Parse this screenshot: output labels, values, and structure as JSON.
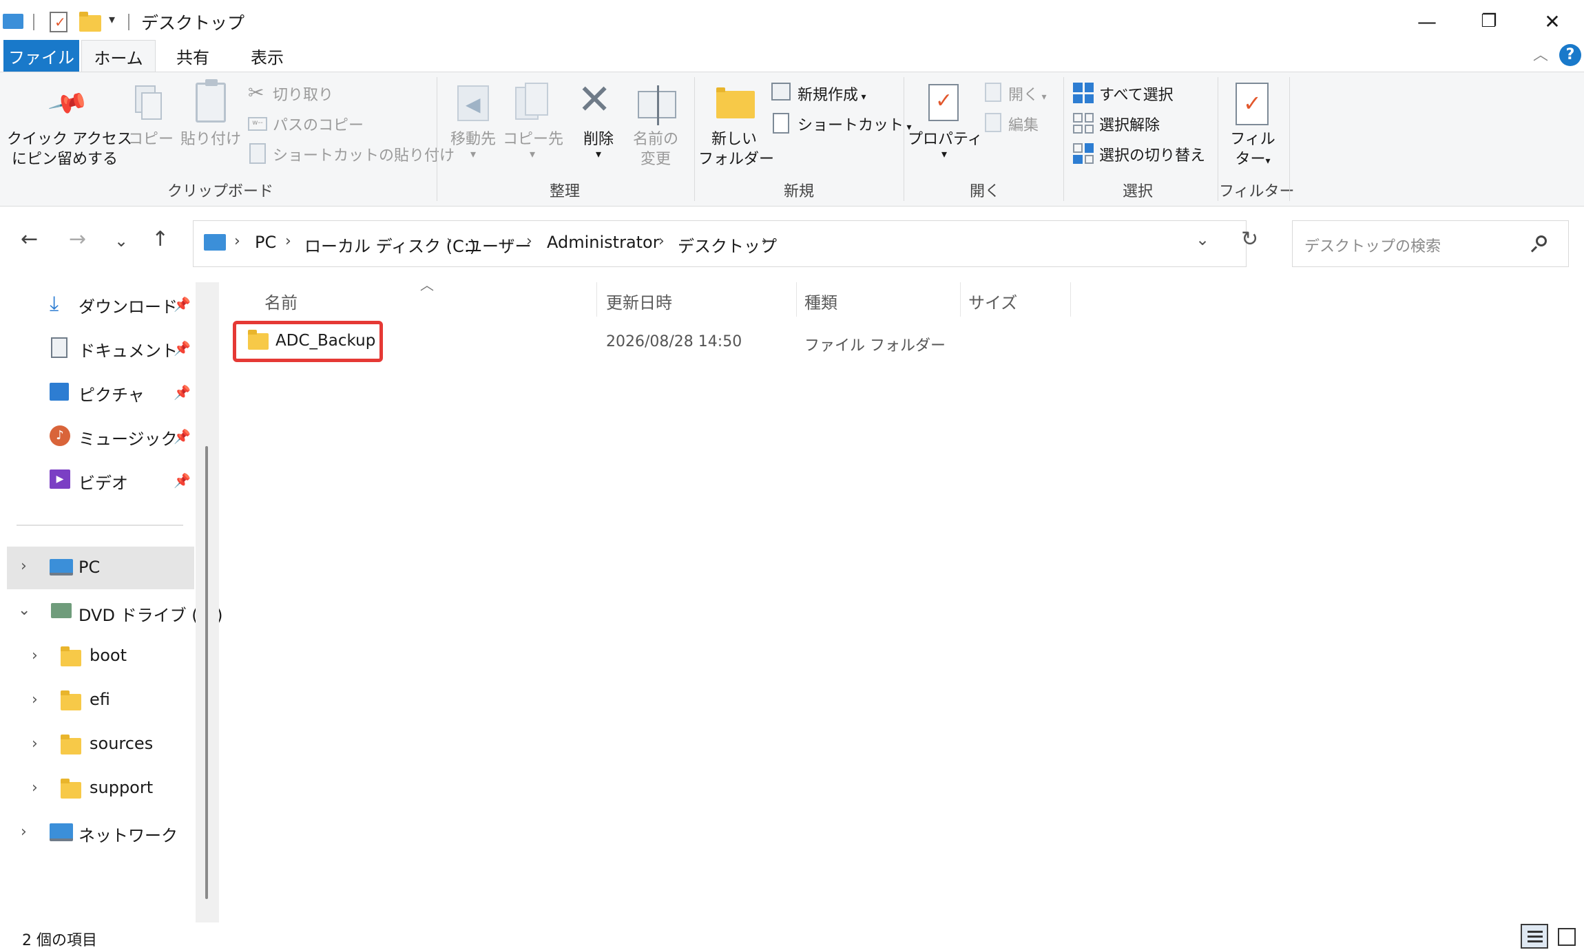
{
  "titlebar": {
    "title": "デスクトップ",
    "minimize": "—",
    "restore": "❐",
    "close": "✕"
  },
  "tabs": [
    {
      "label": "ファイル"
    },
    {
      "label": "ホーム"
    },
    {
      "label": "共有"
    },
    {
      "label": "表示"
    }
  ],
  "ribbon": {
    "clipboard": {
      "pin_line1": "クイック アクセス",
      "pin_line2": "にピン留めする",
      "copy": "コピー",
      "paste": "貼り付け",
      "cut": "切り取り",
      "copy_path": "パスのコピー",
      "paste_shortcut": "ショートカットの貼り付け",
      "label": "クリップボード"
    },
    "organize": {
      "move_to": "移動先",
      "copy_to": "コピー先",
      "delete": "削除",
      "rename_line1": "名前の",
      "rename_line2": "変更",
      "label": "整理"
    },
    "new": {
      "new_folder_line1": "新しい",
      "new_folder_line2": "フォルダー",
      "new_item": "新規作成",
      "shortcut": "ショートカット",
      "label": "新規"
    },
    "open": {
      "properties": "プロパティ",
      "open": "開く",
      "edit": "編集",
      "label": "開く"
    },
    "select": {
      "select_all": "すべて選択",
      "select_none": "選択解除",
      "invert": "選択の切り替え",
      "label": "選択"
    },
    "filter": {
      "filter_line1": "フィル",
      "filter_line2": "ター",
      "label": "フィルター"
    }
  },
  "address": {
    "crumbs": [
      "PC",
      "ローカル ディスク (C:)",
      "ユーザー",
      "Administrator",
      "デスクトップ"
    ],
    "search_placeholder": "デスクトップの検索"
  },
  "nav": {
    "quick": [
      {
        "label": "ダウンロード"
      },
      {
        "label": "ドキュメント"
      },
      {
        "label": "ピクチャ"
      },
      {
        "label": "ミュージック"
      },
      {
        "label": "ビデオ"
      }
    ],
    "pc": "PC",
    "dvd": "DVD ドライブ (D:)",
    "dvd_children": [
      "boot",
      "efi",
      "sources",
      "support"
    ],
    "network": "ネットワーク"
  },
  "files": {
    "headers": [
      "名前",
      "更新日時",
      "種類",
      "サイズ"
    ],
    "rows": [
      {
        "name": "ADC_Backup",
        "modified": "2026/08/28 14:50",
        "type": "ファイル フォルダー",
        "size": ""
      }
    ]
  },
  "status": {
    "count": "2 個の項目"
  },
  "colors": {
    "accent": "#1979ca",
    "highlight": "#e53935",
    "folder": "#f7c948"
  }
}
